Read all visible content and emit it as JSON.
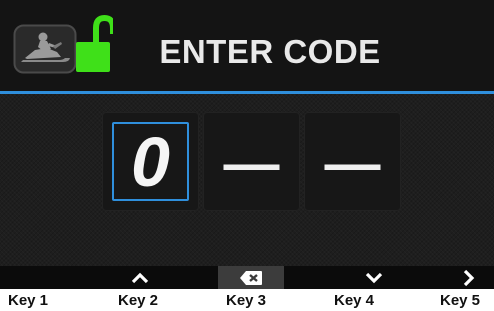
{
  "header": {
    "title": "ENTER CODE",
    "vehicle_icon": "snowmobile-icon",
    "lock_icon": "unlocked-padlock-icon",
    "lock_color": "#3fe019"
  },
  "code_entry": {
    "digits": [
      {
        "value": "0",
        "state": "selected"
      },
      {
        "value": "—",
        "state": "empty"
      },
      {
        "value": "—",
        "state": "empty"
      }
    ]
  },
  "soft_keys": [
    {
      "icon": "",
      "label": "Key 1"
    },
    {
      "icon": "chevron-up-icon",
      "label": "Key 2"
    },
    {
      "icon": "backspace-icon",
      "label": "Key 3"
    },
    {
      "icon": "chevron-down-icon",
      "label": "Key 4"
    },
    {
      "icon": "chevron-right-icon",
      "label": "Key 5"
    }
  ],
  "colors": {
    "accent": "#2f8fdc",
    "lock_green": "#3fe019",
    "text": "#e9e9e9"
  }
}
